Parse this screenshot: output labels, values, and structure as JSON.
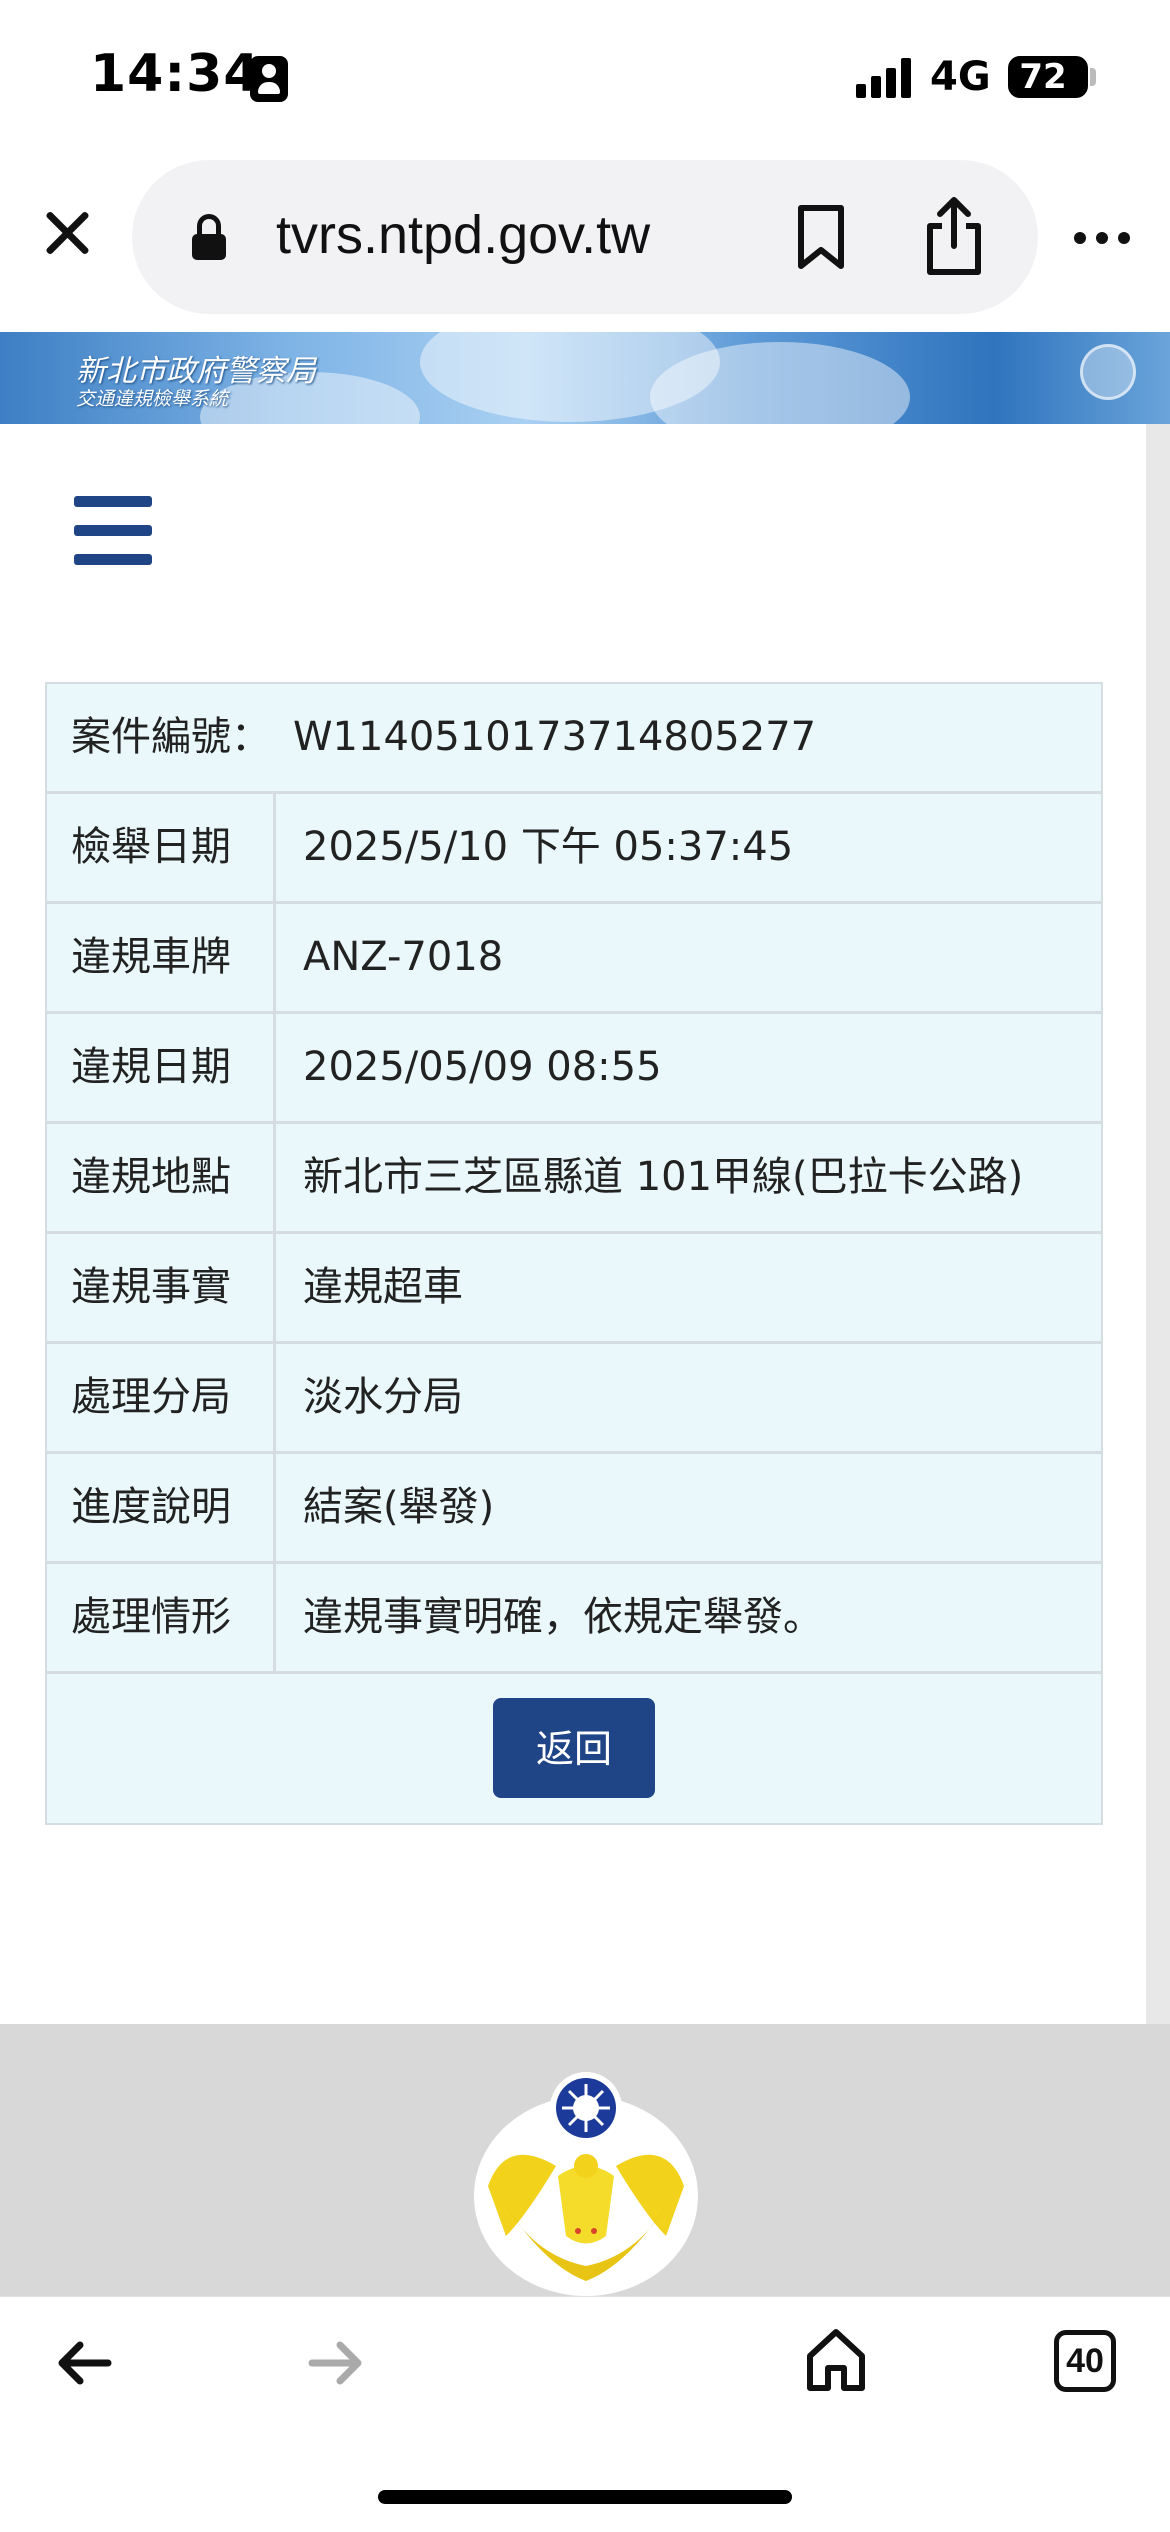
{
  "status_bar": {
    "time": "14:34",
    "network": "4G",
    "battery": "72"
  },
  "browser": {
    "url": "tvrs.ntpd.gov.tw",
    "tabs_count": "40"
  },
  "banner": {
    "title": "新北市政府警察局",
    "subtitle": "交通違規檢舉系統"
  },
  "case": {
    "case_number_label": "案件編號：",
    "case_number": "W1140510173714805277",
    "rows": [
      {
        "label": "檢舉日期",
        "value": "2025/5/10 下午 05:37:45"
      },
      {
        "label": "違規車牌",
        "value": "ANZ-7018"
      },
      {
        "label": "違規日期",
        "value": "2025/05/09 08:55"
      },
      {
        "label": "違規地點",
        "value": "新北市三芝區縣道 101甲線(巴拉卡公路)"
      },
      {
        "label": "違規事實",
        "value": "違規超車"
      },
      {
        "label": "處理分局",
        "value": "淡水分局"
      },
      {
        "label": "進度說明",
        "value": "結案(舉發)"
      },
      {
        "label": "處理情形",
        "value": "違規事實明確，依規定舉發。"
      }
    ],
    "back_label": "返回"
  },
  "colors": {
    "primary": "#1f4587",
    "table_bg": "#eaf8fc",
    "footer_bg": "#d8d8d8"
  }
}
